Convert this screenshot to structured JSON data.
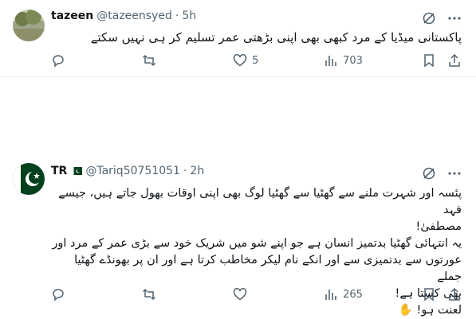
{
  "tweets": [
    {
      "name": "tazeen",
      "handle": "@tazeensyed",
      "separator": "·",
      "time": "5h",
      "lines": [
        "پاکستانی میڈیا کے مرد کبھی بھی اپنی بڑھتی  عمر تسلیم کر ہی نہیں سکتے"
      ],
      "stats": {
        "replies": "",
        "retweets": "",
        "likes": "5",
        "views": "703"
      }
    },
    {
      "name": "TR",
      "flag": "pakistan-flag",
      "handle": "@Tariq50751051",
      "separator": "·",
      "time": "2h",
      "lines": [
        "پئسہ اور شہرت ملنے سے گھٹیا سے گھٹیا لوگ بھی اپنی اوقات بھول جاتے ہیں، جیسے فہد",
        "مصطفیٰ!",
        "یہ انتہائی گھٹیا بدتمیز انسان ہے جو اپنے شو میں شریک خود سے بڑی عمر کے مرد اور",
        "عورتوں سے بدتمیزی سے اور انکے نام لیکر مخاطب کرتا ہے اور ان پر بھونڈے گھٹیا جملے",
        "بھی کستا ہے!",
        "لعنت ہو! ✋"
      ],
      "stats": {
        "replies": "",
        "retweets": "",
        "likes": "",
        "views": "265"
      }
    }
  ],
  "colors": {
    "text": "#0f1419",
    "muted": "#536471",
    "divider": "#eff3f4",
    "flag_green": "#01411c"
  }
}
